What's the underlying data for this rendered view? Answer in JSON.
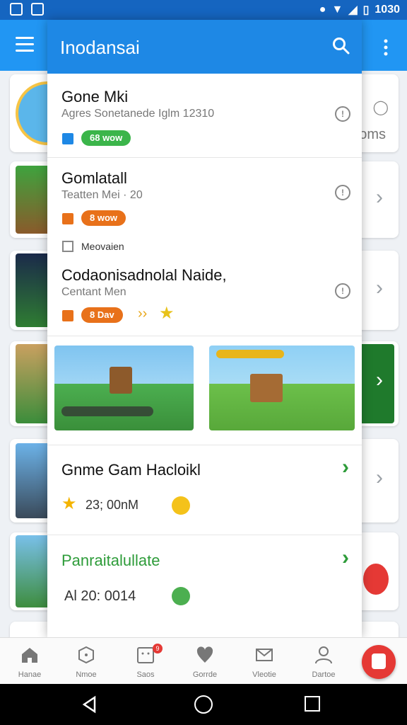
{
  "status_bar": {
    "time": "1030"
  },
  "drawer": {
    "title": "Inodansai",
    "items": [
      {
        "title": "Gone Mki",
        "subtitle": "Agres Sonetanede Iglm 12310",
        "badge": "68 wow",
        "badge_color": "#3bb54a",
        "check_color": "#1e88e5"
      },
      {
        "title": "Gomlatall",
        "subtitle": "Teatten Mei · 20",
        "badge": "8 wow",
        "badge_color": "#e8711a",
        "check_color": "#e8711a"
      },
      {
        "title": "Codaonisadnolal Naide,",
        "subtitle": "Centant Men",
        "badge": "8 Dav",
        "badge_color": "#e8711a",
        "check_color": "#e8711a"
      }
    ],
    "option_label": "Meovaien",
    "game_card": {
      "title": "Gnme Gam Hacloikl",
      "stat": "23; 00nM"
    },
    "promo_card": {
      "title": "Panraitalullate",
      "stat": "Al 20: 0014"
    }
  },
  "background": {
    "card_label": "oms"
  },
  "bottom_nav": [
    {
      "label": "Hanae",
      "icon": "home-icon"
    },
    {
      "label": "Nmoe",
      "icon": "gamepad-icon"
    },
    {
      "label": "Saos",
      "icon": "game-card-icon",
      "badge": "9"
    },
    {
      "label": "Gorrde",
      "icon": "heart-pin-icon"
    },
    {
      "label": "Vleotie",
      "icon": "mail-icon"
    },
    {
      "label": "Dartoe",
      "icon": "profile-icon"
    }
  ],
  "colors": {
    "primary": "#1e88e5",
    "green": "#2e9c3a",
    "orange": "#e8711a"
  }
}
